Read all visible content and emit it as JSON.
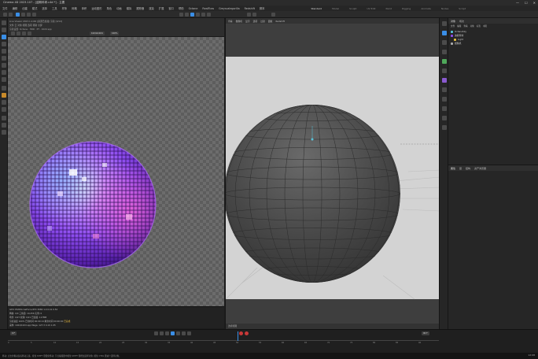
{
  "window": {
    "title": "Cinema 4D 2023.107 - [迪斯科球.c4d *] - 主要",
    "controls": [
      "—",
      "☐",
      "✕"
    ]
  },
  "menu": {
    "items": [
      "文件",
      "编辑",
      "创建",
      "模式",
      "选择",
      "工具",
      "样条",
      "网格",
      "体积",
      "运动图形",
      "角色",
      "动画",
      "模拟",
      "跟踪器",
      "渲染",
      "扩展",
      "窗口",
      "帮助",
      "Octane",
      "RealFlow",
      "Greyscalegorilla",
      "Redshift",
      "脚本"
    ]
  },
  "layouts": {
    "items": [
      "Standard",
      "Model",
      "Sculpt",
      "UV Edit",
      "Paint",
      "Rigging",
      "Animate",
      "Nodes",
      "Script"
    ],
    "active_index": 0
  },
  "left_pane": {
    "header_line1": "Live Viewer 2023.1.2-R6  [资源已加载]  渲染  [0/14]",
    "header_line2": "文件  云  对象  视图  选项  帮助  全屏",
    "header_line3": "渲染设置: Octane  ·  HDR  ·  PT  ·  1024 spp",
    "resolution_label": "1024x1024",
    "zoom_label": "100%"
  },
  "stats": {
    "line1": "GPU: NVIDIA GeForce RTX 3080  1.0  0.41  0.54",
    "line2": "网格: 0/0  三角面: 19,456  实例: 0",
    "line3": "场景: 0/27   纹理: 0/21  已加载: 117MB",
    "line4_prefix": "渲染进度 100%  已用时间 00:00:14  剩余时间 00:00:00",
    "line4_accent": "已完成",
    "line5": "采样: 1024/1024 spp   Mega: 127.3   0.19   1.95"
  },
  "right_view": {
    "menu": [
      "查看",
      "摄像机",
      "显示",
      "选项",
      "过滤",
      "面板",
      "Redshift"
    ],
    "camera_label": "透视视图"
  },
  "object_panel": {
    "tabs": [
      "对象",
      "场次"
    ],
    "menu": [
      "文件",
      "编辑",
      "查看",
      "对象",
      "标签",
      "书签"
    ],
    "objects": [
      "OctaneSky",
      "迪斯科球",
      "Light",
      "摄像机"
    ]
  },
  "attr_panel": {
    "tabs": [
      "属性",
      "层",
      "结构",
      "资产浏览器"
    ]
  },
  "timeline": {
    "frame_current": "0 F",
    "frame_end": "90 F",
    "ticks": [
      "0",
      "5",
      "10",
      "15",
      "20",
      "25",
      "30",
      "35",
      "40",
      "45",
      "50",
      "55",
      "60",
      "65",
      "70",
      "75",
      "80",
      "85",
      "90"
    ]
  },
  "status": {
    "message": "移动: 点击并拖动鼠标移动元素。按住 SHIFT 键量化移动; 节点编辑器中按住 SHIFT 键增加选择对象; 按住 CTRL 键减少选择对象。"
  },
  "taskbar": {
    "time": "12:08"
  },
  "colors": {
    "accent_blue": "#3a8ee6",
    "accent_cyan": "#58c3d8",
    "warning_yellow": "#f0c040",
    "disco_purple": "#8e4df0"
  }
}
